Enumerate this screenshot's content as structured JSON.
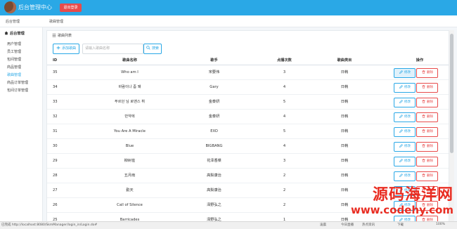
{
  "app": {
    "title": "后台管理中心",
    "logout_label": "退出登录",
    "breadcrumb": "后台管理",
    "page": "歌曲管理"
  },
  "sidebar": {
    "header": "后台管理",
    "items": [
      {
        "label": "用户管理"
      },
      {
        "label": "员工管理"
      },
      {
        "label": "包间管理"
      },
      {
        "label": "商品管理"
      },
      {
        "label": "歌曲管理"
      },
      {
        "label": "商品订单管理"
      },
      {
        "label": "包间订单管理"
      }
    ]
  },
  "panel": {
    "title": "歌曲列表",
    "add_label": "添加歌曲",
    "search_placeholder": "请输入歌曲名称",
    "search_label": "搜索"
  },
  "table": {
    "headers": [
      "ID",
      "歌曲名称",
      "歌手",
      "点播次数",
      "歌曲类目",
      "操作"
    ],
    "rows": [
      {
        "id": "35",
        "name": "Who am I",
        "singer": "宋要伟",
        "plays": "3",
        "category": "日韩"
      },
      {
        "id": "34",
        "name": "바람이나 좀 쐐",
        "singer": "Gary",
        "plays": "4",
        "category": "日韩"
      },
      {
        "id": "33",
        "name": "푸르던 님 로맨스 뷔",
        "singer": "金泰妍",
        "plays": "5",
        "category": "日韩"
      },
      {
        "id": "32",
        "name": "만약에",
        "singer": "金泰妍",
        "plays": "4",
        "category": "日韩"
      },
      {
        "id": "31",
        "name": "You Are A Miracle",
        "singer": "EXO",
        "plays": "5",
        "category": "日韩"
      },
      {
        "id": "30",
        "name": "Blue",
        "singer": "BIGBANG",
        "plays": "4",
        "category": "日韩"
      },
      {
        "id": "29",
        "name": "柳树雀",
        "singer": "花泽香菜",
        "plays": "3",
        "category": "日韩"
      },
      {
        "id": "28",
        "name": "五月雨",
        "singer": "高梨康治",
        "plays": "2",
        "category": "日韩"
      },
      {
        "id": "27",
        "name": "勤天",
        "singer": "高梨康治",
        "plays": "2",
        "category": "日韩"
      },
      {
        "id": "26",
        "name": "Call of Silence",
        "singer": "泽野弘之",
        "plays": "2",
        "category": "日韩"
      },
      {
        "id": "25",
        "name": "Barricades",
        "singer": "泽野弘之",
        "plays": "1",
        "category": "日韩"
      }
    ],
    "edit_label": "修改",
    "delete_label": "删除"
  },
  "statusbar": {
    "url": "已完成 http://localhost:8080/SkmManager/login_in/Login.do#",
    "items": [
      "凌晨",
      "今日直播",
      "热点资讯",
      "下载",
      "100%"
    ]
  },
  "watermark": {
    "title": "源码海洋网",
    "url": "www.codehy.com"
  },
  "colors": {
    "accent": "#2aa8e6",
    "danger": "#e84b4b",
    "watermark": "#e92d22"
  }
}
